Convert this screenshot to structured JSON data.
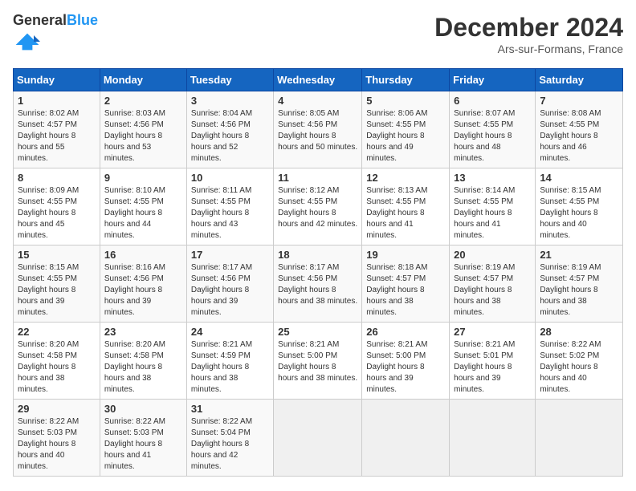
{
  "header": {
    "logo_text_general": "General",
    "logo_text_blue": "Blue",
    "month_title": "December 2024",
    "location": "Ars-sur-Formans, France"
  },
  "calendar": {
    "days_of_week": [
      "Sunday",
      "Monday",
      "Tuesday",
      "Wednesday",
      "Thursday",
      "Friday",
      "Saturday"
    ],
    "weeks": [
      [
        null,
        {
          "day": 2,
          "sunrise": "8:03 AM",
          "sunset": "4:56 PM",
          "daylight": "8 hours and 53 minutes."
        },
        {
          "day": 3,
          "sunrise": "8:04 AM",
          "sunset": "4:56 PM",
          "daylight": "8 hours and 52 minutes."
        },
        {
          "day": 4,
          "sunrise": "8:05 AM",
          "sunset": "4:56 PM",
          "daylight": "8 hours and 50 minutes."
        },
        {
          "day": 5,
          "sunrise": "8:06 AM",
          "sunset": "4:55 PM",
          "daylight": "8 hours and 49 minutes."
        },
        {
          "day": 6,
          "sunrise": "8:07 AM",
          "sunset": "4:55 PM",
          "daylight": "8 hours and 48 minutes."
        },
        {
          "day": 7,
          "sunrise": "8:08 AM",
          "sunset": "4:55 PM",
          "daylight": "8 hours and 46 minutes."
        }
      ],
      [
        {
          "day": 1,
          "sunrise": "8:02 AM",
          "sunset": "4:57 PM",
          "daylight": "8 hours and 55 minutes."
        },
        {
          "day": 9,
          "sunrise": "8:10 AM",
          "sunset": "4:55 PM",
          "daylight": "8 hours and 44 minutes."
        },
        {
          "day": 10,
          "sunrise": "8:11 AM",
          "sunset": "4:55 PM",
          "daylight": "8 hours and 43 minutes."
        },
        {
          "day": 11,
          "sunrise": "8:12 AM",
          "sunset": "4:55 PM",
          "daylight": "8 hours and 42 minutes."
        },
        {
          "day": 12,
          "sunrise": "8:13 AM",
          "sunset": "4:55 PM",
          "daylight": "8 hours and 41 minutes."
        },
        {
          "day": 13,
          "sunrise": "8:14 AM",
          "sunset": "4:55 PM",
          "daylight": "8 hours and 41 minutes."
        },
        {
          "day": 14,
          "sunrise": "8:15 AM",
          "sunset": "4:55 PM",
          "daylight": "8 hours and 40 minutes."
        }
      ],
      [
        {
          "day": 8,
          "sunrise": "8:09 AM",
          "sunset": "4:55 PM",
          "daylight": "8 hours and 45 minutes."
        },
        {
          "day": 16,
          "sunrise": "8:16 AM",
          "sunset": "4:56 PM",
          "daylight": "8 hours and 39 minutes."
        },
        {
          "day": 17,
          "sunrise": "8:17 AM",
          "sunset": "4:56 PM",
          "daylight": "8 hours and 39 minutes."
        },
        {
          "day": 18,
          "sunrise": "8:17 AM",
          "sunset": "4:56 PM",
          "daylight": "8 hours and 38 minutes."
        },
        {
          "day": 19,
          "sunrise": "8:18 AM",
          "sunset": "4:57 PM",
          "daylight": "8 hours and 38 minutes."
        },
        {
          "day": 20,
          "sunrise": "8:19 AM",
          "sunset": "4:57 PM",
          "daylight": "8 hours and 38 minutes."
        },
        {
          "day": 21,
          "sunrise": "8:19 AM",
          "sunset": "4:57 PM",
          "daylight": "8 hours and 38 minutes."
        }
      ],
      [
        {
          "day": 15,
          "sunrise": "8:15 AM",
          "sunset": "4:55 PM",
          "daylight": "8 hours and 39 minutes."
        },
        {
          "day": 23,
          "sunrise": "8:20 AM",
          "sunset": "4:58 PM",
          "daylight": "8 hours and 38 minutes."
        },
        {
          "day": 24,
          "sunrise": "8:21 AM",
          "sunset": "4:59 PM",
          "daylight": "8 hours and 38 minutes."
        },
        {
          "day": 25,
          "sunrise": "8:21 AM",
          "sunset": "5:00 PM",
          "daylight": "8 hours and 38 minutes."
        },
        {
          "day": 26,
          "sunrise": "8:21 AM",
          "sunset": "5:00 PM",
          "daylight": "8 hours and 39 minutes."
        },
        {
          "day": 27,
          "sunrise": "8:21 AM",
          "sunset": "5:01 PM",
          "daylight": "8 hours and 39 minutes."
        },
        {
          "day": 28,
          "sunrise": "8:22 AM",
          "sunset": "5:02 PM",
          "daylight": "8 hours and 40 minutes."
        }
      ],
      [
        {
          "day": 22,
          "sunrise": "8:20 AM",
          "sunset": "4:58 PM",
          "daylight": "8 hours and 38 minutes."
        },
        {
          "day": 30,
          "sunrise": "8:22 AM",
          "sunset": "5:03 PM",
          "daylight": "8 hours and 41 minutes."
        },
        {
          "day": 31,
          "sunrise": "8:22 AM",
          "sunset": "5:04 PM",
          "daylight": "8 hours and 42 minutes."
        },
        null,
        null,
        null,
        null
      ],
      [
        {
          "day": 29,
          "sunrise": "8:22 AM",
          "sunset": "5:03 PM",
          "daylight": "8 hours and 40 minutes."
        },
        null,
        null,
        null,
        null,
        null,
        null
      ]
    ]
  }
}
